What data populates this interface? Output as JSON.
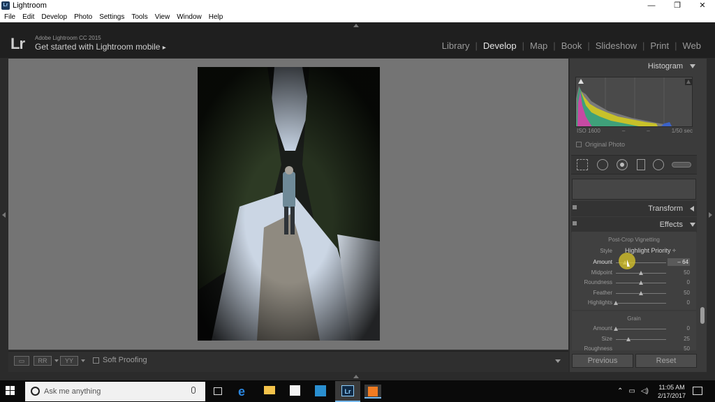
{
  "window": {
    "title": "Lightroom",
    "app_icon_text": "Lr",
    "minimize_glyph": "—",
    "restore_glyph": "❐",
    "close_glyph": "✕"
  },
  "menu": [
    "File",
    "Edit",
    "Develop",
    "Photo",
    "Settings",
    "Tools",
    "View",
    "Window",
    "Help"
  ],
  "identity": {
    "logo": "Lr",
    "product": "Adobe Lightroom CC 2015",
    "tagline": "Get started with Lightroom mobile",
    "tagline_arrow": "▸"
  },
  "modules": [
    {
      "label": "Library",
      "active": false
    },
    {
      "label": "Develop",
      "active": true
    },
    {
      "label": "Map",
      "active": false
    },
    {
      "label": "Book",
      "active": false
    },
    {
      "label": "Slideshow",
      "active": false
    },
    {
      "label": "Print",
      "active": false
    },
    {
      "label": "Web",
      "active": false
    }
  ],
  "toolbar": {
    "view_button": "▭",
    "compare_button": "RR",
    "survey_button": "YY",
    "soft_proofing_label": "Soft Proofing"
  },
  "histogram": {
    "title": "Histogram",
    "iso": "ISO 1600",
    "dash1": "–",
    "dash2": "–",
    "shutter": "1/50 sec",
    "original_photo_label": "Original Photo"
  },
  "panels": {
    "transform": "Transform",
    "effects": "Effects"
  },
  "vignetting": {
    "section": "Post-Crop Vignetting",
    "style_label": "Style",
    "style_value": "Highlight Priority ÷",
    "rows": [
      {
        "label": "Amount",
        "value": "– 64",
        "level": 0.18
      },
      {
        "label": "Midpoint",
        "value": "50",
        "level": 0.5
      },
      {
        "label": "Roundness",
        "value": "0",
        "level": 0.5
      },
      {
        "label": "Feather",
        "value": "50",
        "level": 0.5
      },
      {
        "label": "Highlights",
        "value": "0",
        "level": 0.0
      }
    ]
  },
  "grain": {
    "section": "Grain",
    "rows": [
      {
        "label": "Amount",
        "value": "0",
        "level": 0.0
      },
      {
        "label": "Size",
        "value": "25",
        "level": 0.25
      },
      {
        "label": "Roughness",
        "value": "50",
        "level": 0.5
      }
    ]
  },
  "buttons": {
    "previous": "Previous",
    "reset": "Reset"
  },
  "taskbar": {
    "search_placeholder": "Ask me anything",
    "time": "11:05 AM",
    "date": "2/17/2017",
    "lr_icon": "Lr",
    "edge_icon": "e",
    "tray_chevron": "⌃",
    "tray_power": "▭",
    "tray_volume": "◁)"
  },
  "colors": {
    "accent": "#76b9ed",
    "panel_bg": "#3b3b3b",
    "canvas_bg": "#747474",
    "cursor_highlight": "#dcc828"
  }
}
